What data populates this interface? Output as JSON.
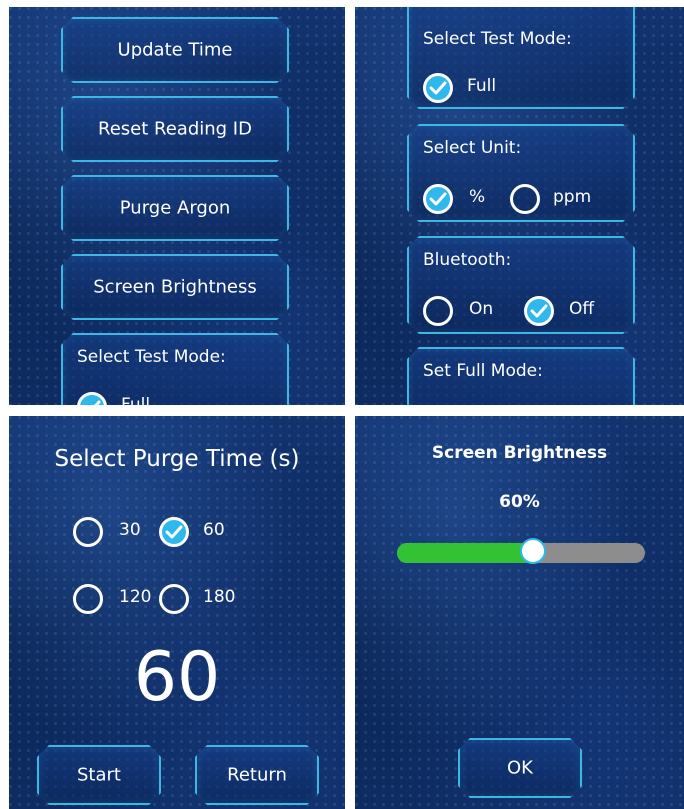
{
  "panel_menu": {
    "buttons": [
      "Update Time",
      "Reset Reading ID",
      "Purge Argon",
      "Screen Brightness"
    ],
    "test_mode_card": {
      "title": "Select Test Mode:",
      "option": "Full"
    }
  },
  "panel_settings": {
    "test_mode": {
      "title": "Select Test Mode:",
      "option": "Full",
      "checked": true
    },
    "unit": {
      "title": "Select Unit:",
      "options": [
        "%",
        "ppm"
      ],
      "selected": "%"
    },
    "bluetooth": {
      "title": "Bluetooth:",
      "options": [
        "On",
        "Off"
      ],
      "selected": "Off"
    },
    "full_mode": {
      "title": "Set Full Mode:"
    }
  },
  "panel_purge": {
    "title": "Select Purge Time (s)",
    "options": [
      "30",
      "60",
      "120",
      "180"
    ],
    "selected": "60",
    "value": "60",
    "start_label": "Start",
    "return_label": "Return"
  },
  "panel_brightness": {
    "title": "Screen Brightness",
    "value_label": "60%",
    "level": 0.55,
    "ok_label": "OK"
  },
  "colors": {
    "accent": "#2fb8ec",
    "border_glow": "#3fb6e4",
    "slider_fill": "#33c233",
    "slider_track": "#8d8d8d",
    "background": "#0d2a5e"
  },
  "icons": [
    "check-icon"
  ]
}
